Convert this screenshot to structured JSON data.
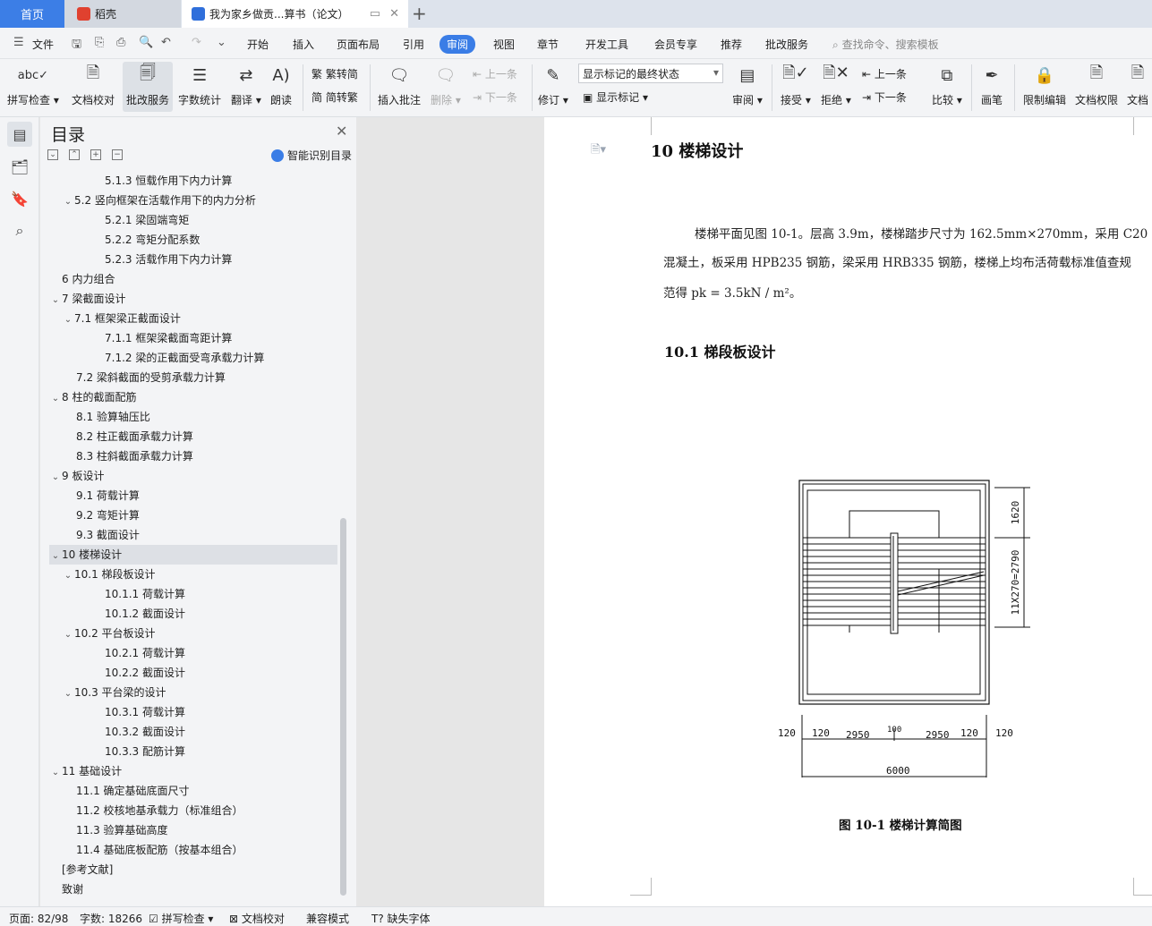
{
  "tabs": {
    "home": "首页",
    "daoke": "稻壳",
    "doc_title": "我为家乡做贡...算书（论文）",
    "colors": {
      "home_bg": "#3c7ee6",
      "daoke_logo": "#e0412f",
      "doc_logo": "#2f6fdb"
    }
  },
  "menu": {
    "file": "文件",
    "items": [
      "开始",
      "插入",
      "页面布局",
      "引用",
      "审阅",
      "视图",
      "章节",
      "开发工具",
      "会员专享",
      "推荐",
      "批改服务"
    ],
    "active": "审阅",
    "search_placeholder": "查找命令、搜索模板"
  },
  "ribbon": {
    "spellcheck": "拼写检查",
    "doc_check": "文档校对",
    "review_service": "批改服务",
    "word_count": "字数统计",
    "translate": "翻译",
    "read_aloud": "朗读",
    "trad": "繁转简",
    "simp": "简转繁",
    "insert_comment": "插入批注",
    "delete": "删除",
    "prev_comment": "上一条",
    "next_comment": "下一条",
    "revise": "修订",
    "markup_state": "显示标记的最终状态",
    "show_markup": "显示标记",
    "review_pane": "审阅",
    "accept": "接受",
    "reject": "拒绝",
    "prev_change": "上一条",
    "next_change": "下一条",
    "compare": "比较",
    "pen": "画笔",
    "restrict_edit": "限制编辑",
    "doc_permission": "文档权限",
    "doc_more": "文档"
  },
  "toc": {
    "title": "目录",
    "smart": "智能识别目录",
    "items": [
      {
        "text": "5.1.3  恒载作用下内力计算",
        "level": 3,
        "chev": ""
      },
      {
        "text": "5.2  竖向框架在活载作用下的内力分析",
        "level": 2,
        "chev": "v"
      },
      {
        "text": "5.2.1    梁固端弯矩",
        "level": 3,
        "chev": ""
      },
      {
        "text": "5.2.2    弯矩分配系数",
        "level": 3,
        "chev": ""
      },
      {
        "text": "5.2.3    活载作用下内力计算",
        "level": 3,
        "chev": ""
      },
      {
        "text": "6  内力组合",
        "level": 1,
        "chev": ""
      },
      {
        "text": "7  梁截面设计",
        "level": 1,
        "chev": "v"
      },
      {
        "text": "7.1  框架梁正截面设计",
        "level": 2,
        "chev": "v"
      },
      {
        "text": "7.1.1  框架梁截面弯距计算",
        "level": 3,
        "chev": ""
      },
      {
        "text": "7.1.2  梁的正截面受弯承载力计算",
        "level": 3,
        "chev": ""
      },
      {
        "text": "7.2  梁斜截面的受剪承载力计算",
        "level": 2,
        "chev": ""
      },
      {
        "text": "8  柱的截面配筋",
        "level": 1,
        "chev": "v"
      },
      {
        "text": "8.1  验算轴压比",
        "level": 2,
        "chev": ""
      },
      {
        "text": "8.2  柱正截面承载力计算",
        "level": 2,
        "chev": ""
      },
      {
        "text": "8.3  柱斜截面承载力计算",
        "level": 2,
        "chev": ""
      },
      {
        "text": "9 板设计",
        "level": 1,
        "chev": "v"
      },
      {
        "text": "9.1  荷载计算",
        "level": 2,
        "chev": ""
      },
      {
        "text": "9.2  弯矩计算",
        "level": 2,
        "chev": ""
      },
      {
        "text": "9.3  截面设计",
        "level": 2,
        "chev": ""
      },
      {
        "text": "10  楼梯设计",
        "level": 1,
        "chev": "v",
        "selected": true
      },
      {
        "text": "10.1  梯段板设计",
        "level": 2,
        "chev": "v"
      },
      {
        "text": "10.1.1  荷载计算",
        "level": 3,
        "chev": ""
      },
      {
        "text": "10.1.2  截面设计",
        "level": 3,
        "chev": ""
      },
      {
        "text": "10.2  平台板设计",
        "level": 2,
        "chev": "v"
      },
      {
        "text": "10.2.1  荷载计算",
        "level": 3,
        "chev": ""
      },
      {
        "text": "10.2.2  截面设计",
        "level": 3,
        "chev": ""
      },
      {
        "text": "10.3  平台梁的设计",
        "level": 2,
        "chev": "v"
      },
      {
        "text": "10.3.1  荷载计算",
        "level": 3,
        "chev": ""
      },
      {
        "text": "10.3.2  截面设计",
        "level": 3,
        "chev": ""
      },
      {
        "text": "10.3.3  配筋计算",
        "level": 3,
        "chev": ""
      },
      {
        "text": "11  基础设计",
        "level": 1,
        "chev": "v"
      },
      {
        "text": "11.1 确定基础底面尺寸",
        "level": 2,
        "chev": ""
      },
      {
        "text": "11.2  校核地基承载力（标准组合）",
        "level": 2,
        "chev": ""
      },
      {
        "text": "11.3  验算基础高度",
        "level": 2,
        "chev": ""
      },
      {
        "text": "11.4  基础底板配筋（按基本组合）",
        "level": 2,
        "chev": ""
      },
      {
        "text": "[参考文献]",
        "level": 1,
        "chev": ""
      },
      {
        "text": "致谢",
        "level": 1,
        "chev": ""
      }
    ]
  },
  "doc": {
    "h1": "10  楼梯设计",
    "p1": "楼梯平面见图 10-1。层高 3.9m，楼梯踏步尺寸为 162.5mm×270mm，采用 C20",
    "p2": "混凝土，板采用 HPB235 钢筋，梁采用 HRB335 钢筋，楼梯上均布活荷载标准值查规",
    "p3": "范得 pk = 3.5kN / m²。",
    "h2": "10.1  梯段板设计",
    "figure": {
      "dim_1620": "1620",
      "dim_run": "11X270=2790",
      "d120": "120",
      "d2950": "2950",
      "d100": "100",
      "d6000": "6000"
    },
    "caption": "图 10-1  楼梯计算简图"
  },
  "status": {
    "page": "页面: 82/98",
    "words": "字数: 18266",
    "spell": "拼写检查",
    "proof": "文档校对",
    "compat": "兼容模式",
    "missing_font": "缺失字体"
  }
}
